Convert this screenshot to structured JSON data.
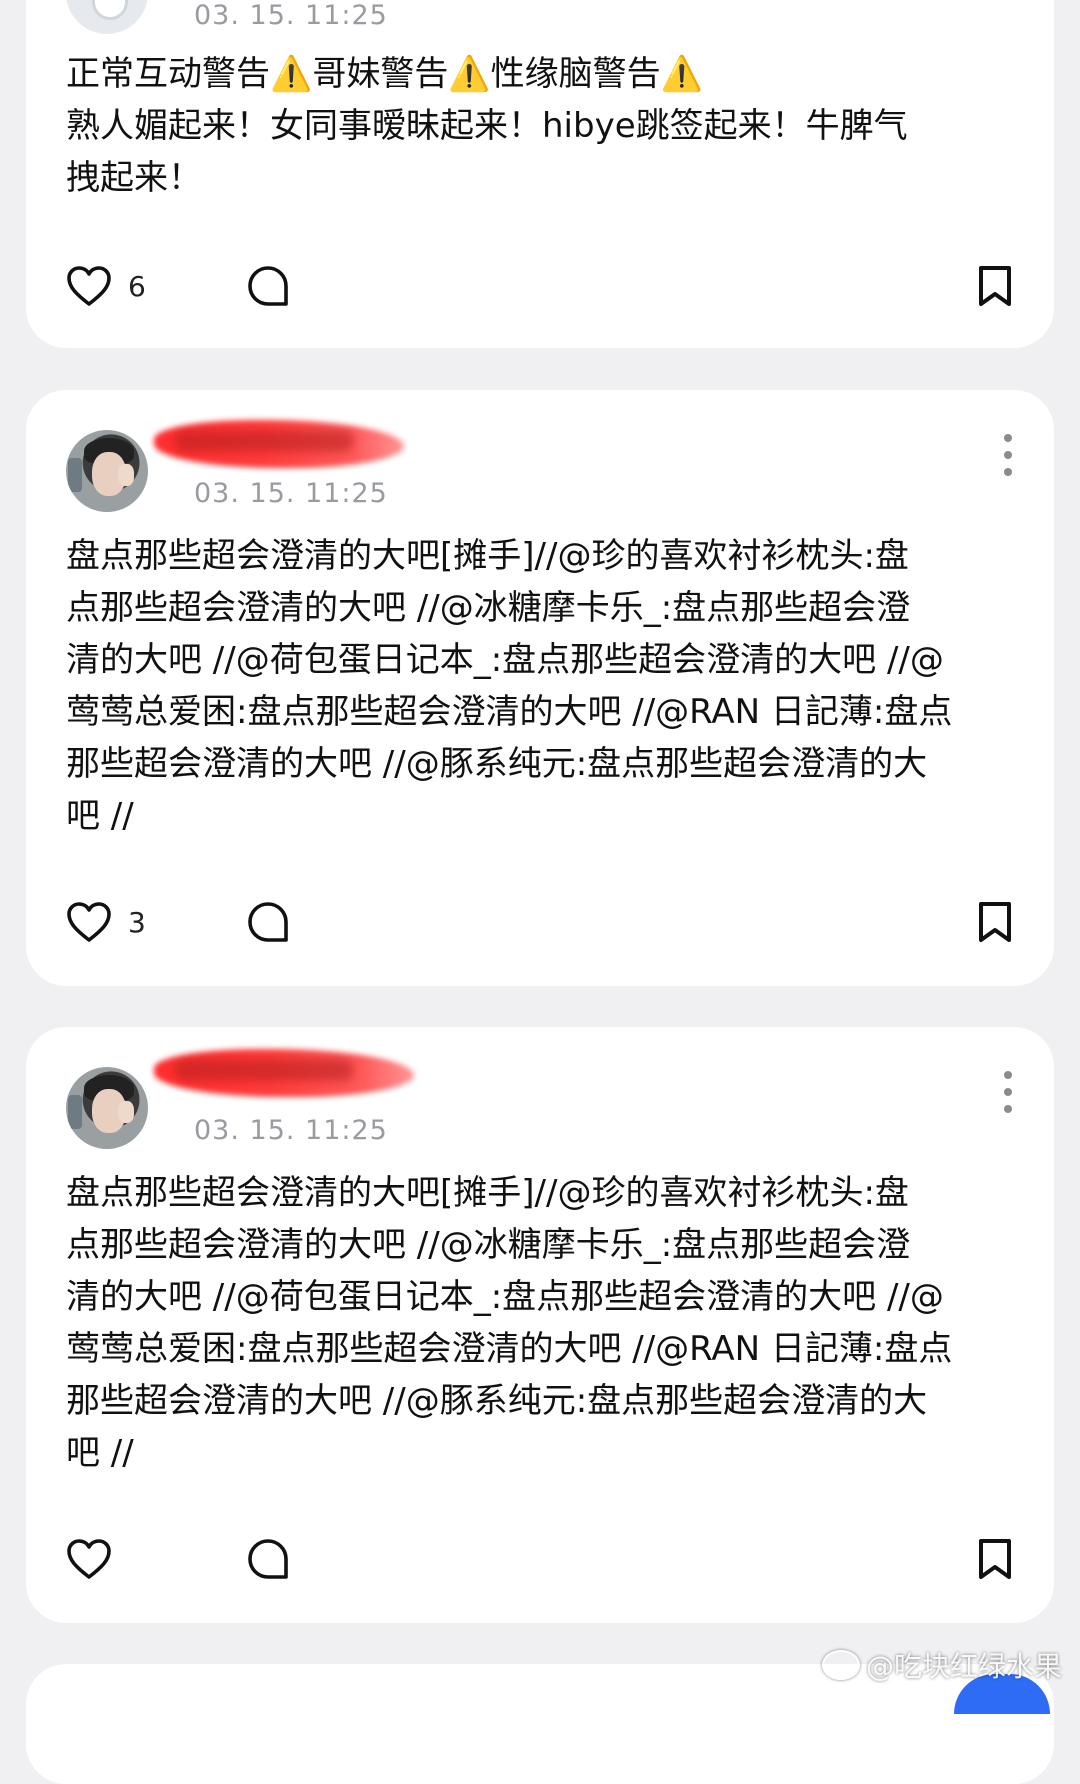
{
  "posts": [
    {
      "timestamp": "03. 15. 11:25",
      "content_lines": [
        "正常互动警告⚠️哥妹警告⚠️性缘脑警告⚠️",
        "熟人媚起来！女同事暧昧起来！hibye跳签起来！牛脾气",
        "拽起来！"
      ],
      "like_count": "6"
    },
    {
      "timestamp": "03. 15. 11:25",
      "content_lines": [
        "盘点那些超会澄清的大吧[摊手]//@珍的喜欢衬衫枕头:盘",
        "点那些超会澄清的大吧 //@冰糖摩卡乐_:盘点那些超会澄",
        "清的大吧 //@荷包蛋日记本_:盘点那些超会澄清的大吧 //@",
        "莺莺总爱困:盘点那些超会澄清的大吧 //@RAN 日記薄:盘点",
        "那些超会澄清的大吧 //@豚系纯元:盘点那些超会澄清的大",
        "吧 //"
      ],
      "like_count": "3"
    },
    {
      "timestamp": "03. 15. 11:25",
      "content_lines": [
        "盘点那些超会澄清的大吧[摊手]//@珍的喜欢衬衫枕头:盘",
        "点那些超会澄清的大吧 //@冰糖摩卡乐_:盘点那些超会澄",
        "清的大吧 //@荷包蛋日记本_:盘点那些超会澄清的大吧 //@",
        "莺莺总爱困:盘点那些超会澄清的大吧 //@RAN 日記薄:盘点",
        "那些超会澄清的大吧 //@豚系纯元:盘点那些超会澄清的大",
        "吧 //"
      ],
      "like_count": ""
    }
  ],
  "icons": {
    "like": "heart-icon",
    "comment": "comment-bubble-icon",
    "bookmark": "bookmark-icon",
    "more": "more-vertical-icon"
  },
  "watermark": "@吃块红绿水果",
  "colors": {
    "background": "#f0f0f2",
    "card": "#ffffff",
    "timestamp": "#9a9aa0",
    "redaction": "#ff2d2d",
    "fab": "#2f6cf6"
  }
}
